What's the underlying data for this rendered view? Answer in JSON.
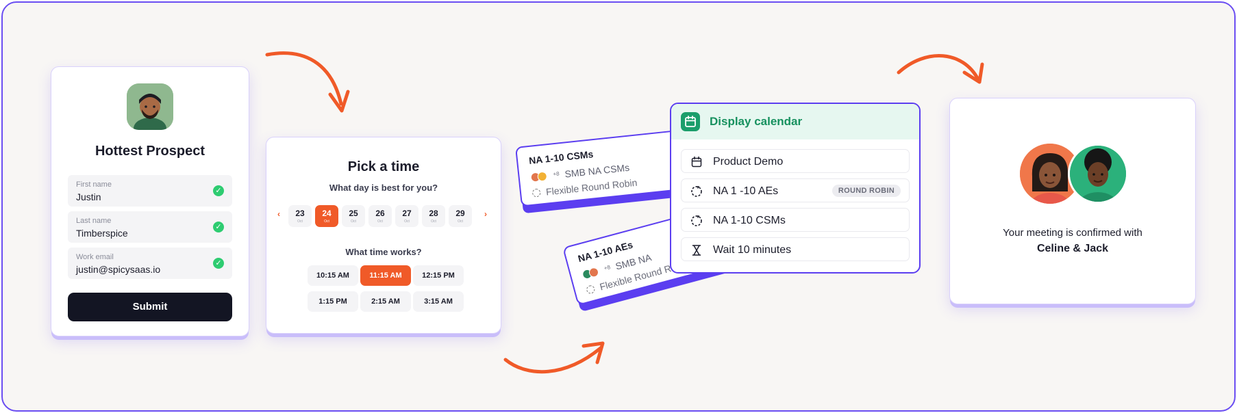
{
  "colors": {
    "accent_orange": "#f05a28",
    "accent_purple": "#6a4df2",
    "calendar_green": "#17915f",
    "submit_dark": "#131523",
    "check_green": "#2ecc71"
  },
  "prospect_form": {
    "avatar_icon": "prospect-avatar",
    "title": "Hottest Prospect",
    "fields": [
      {
        "label": "First name",
        "value": "Justin",
        "status_icon": "check-icon"
      },
      {
        "label": "Last name",
        "value": "Timberspice",
        "status_icon": "check-icon"
      },
      {
        "label": "Work email",
        "value": "justin@spicysaas.io",
        "status_icon": "check-icon"
      }
    ],
    "submit_label": "Submit"
  },
  "scheduler": {
    "title": "Pick a time",
    "day_question": "What day is best for you?",
    "prev_icon": "chevron-left-icon",
    "next_icon": "chevron-right-icon",
    "dates": [
      {
        "day": "23",
        "month": "Oct"
      },
      {
        "day": "24",
        "month": "Oct",
        "selected": true
      },
      {
        "day": "25",
        "month": "Oct"
      },
      {
        "day": "26",
        "month": "Oct"
      },
      {
        "day": "27",
        "month": "Oct"
      },
      {
        "day": "28",
        "month": "Oct"
      },
      {
        "day": "29",
        "month": "Oct"
      }
    ],
    "time_question": "What time works?",
    "times": [
      {
        "label": "10:15 AM"
      },
      {
        "label": "11:15 AM",
        "selected": true
      },
      {
        "label": "12:15 PM"
      },
      {
        "label": "1:15 PM"
      },
      {
        "label": "2:15 AM"
      },
      {
        "label": "3:15 AM"
      }
    ]
  },
  "routing_cards": [
    {
      "title": "NA 1-10 CSMs",
      "more_count": "+8",
      "team": "SMB NA CSMs",
      "method": "Flexible Round Robin"
    },
    {
      "title": "NA 1-10 AEs",
      "more_count": "+8",
      "team": "SMB NA",
      "method": "Flexible Round Robin"
    }
  ],
  "display_calendar": {
    "header_icon": "calendar-icon",
    "title": "Display calendar",
    "rows": [
      {
        "icon": "calendar-icon",
        "label": "Product Demo"
      },
      {
        "icon": "round-robin-icon",
        "label": "NA 1 -10 AEs",
        "badge": "ROUND ROBIN"
      },
      {
        "icon": "round-robin-icon",
        "label": "NA 1-10 CSMs"
      },
      {
        "icon": "hourglass-icon",
        "label": "Wait 10 minutes"
      }
    ]
  },
  "confirmation": {
    "avatars": [
      "celine-avatar",
      "jack-avatar"
    ],
    "line1": "Your meeting is confirmed with",
    "line2": "Celine & Jack"
  }
}
